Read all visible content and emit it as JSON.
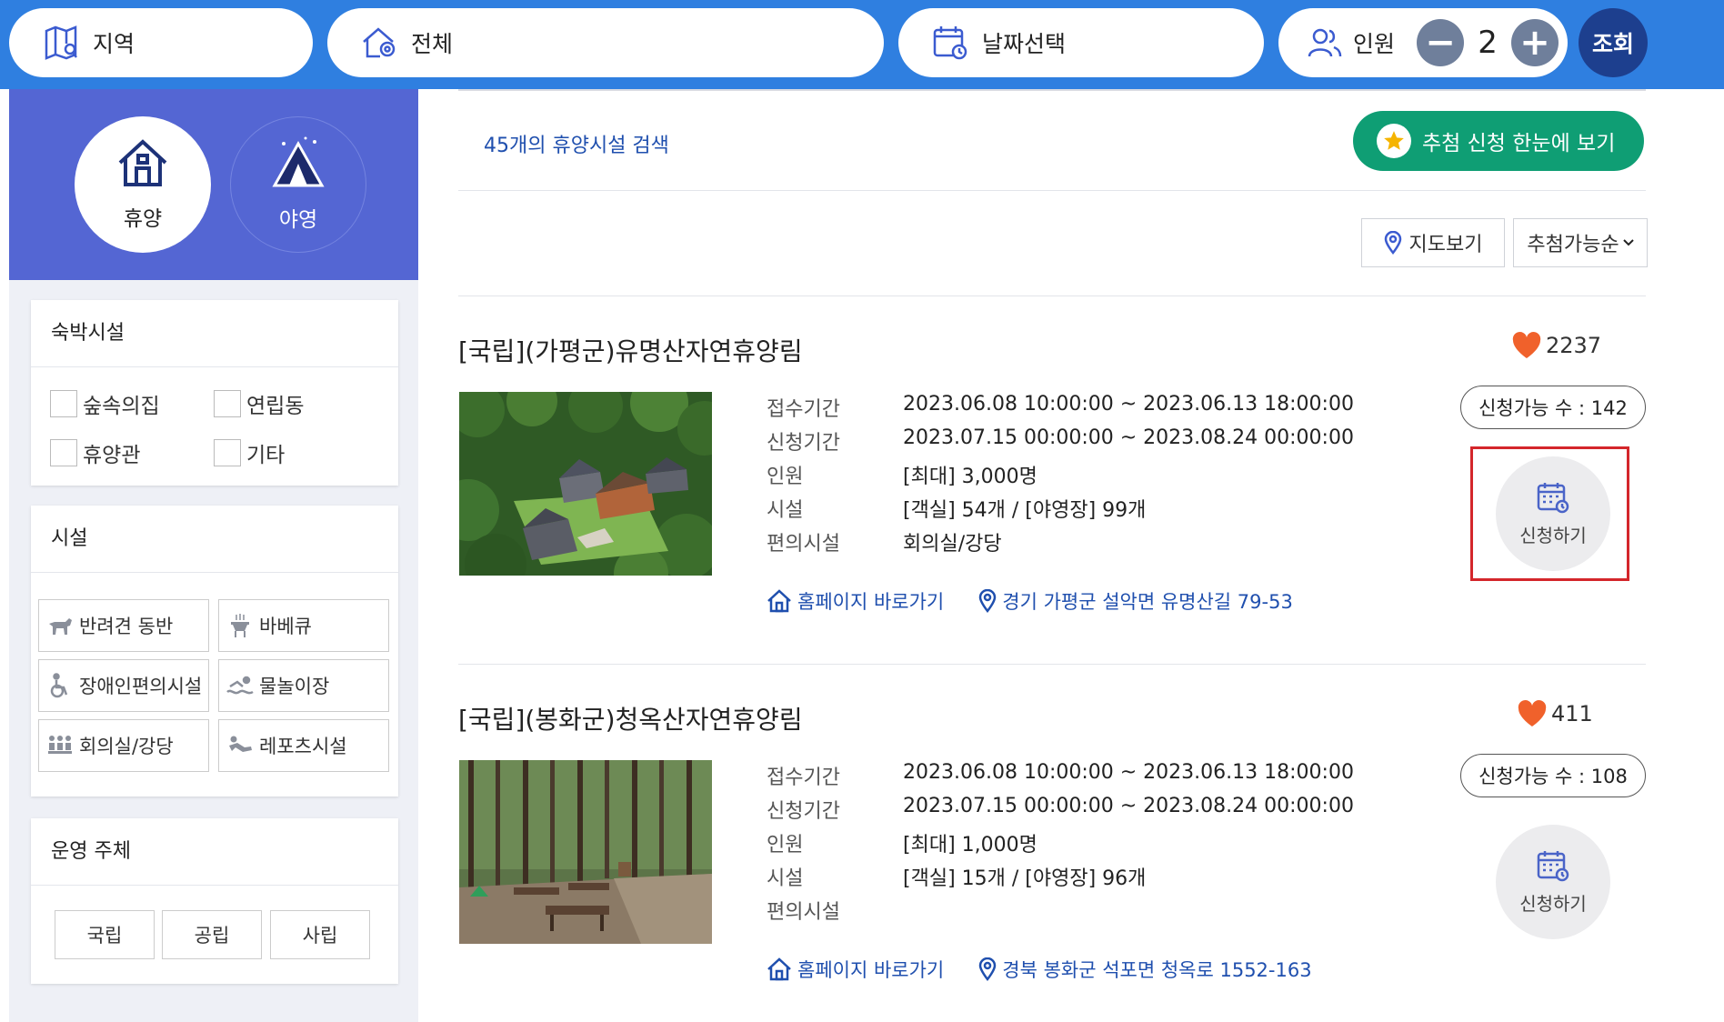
{
  "search_bar": {
    "region_label": "지역",
    "type_label": "전체",
    "date_label": "날짜선택",
    "people_label": "인원",
    "people_count": "2",
    "minus_symbol": "−",
    "plus_symbol": "+",
    "search_button": "조회"
  },
  "category_tabs": [
    {
      "label": "휴양",
      "icon": "house-icon",
      "active": true
    },
    {
      "label": "야영",
      "icon": "tent-icon",
      "active": false
    }
  ],
  "filters": {
    "lodging": {
      "title": "숙박시설",
      "options": [
        "숲속의집",
        "연립동",
        "휴양관",
        "기타"
      ]
    },
    "facility": {
      "title": "시설",
      "options": [
        {
          "label": "반려견 동반",
          "icon": "dog-icon"
        },
        {
          "label": "바베큐",
          "icon": "grill-icon"
        },
        {
          "label": "장애인편의시설",
          "icon": "wheelchair-icon"
        },
        {
          "label": "물놀이장",
          "icon": "swimming-icon"
        },
        {
          "label": "회의실/강당",
          "icon": "meeting-icon"
        },
        {
          "label": "레포츠시설",
          "icon": "leisure-sports-icon"
        }
      ]
    },
    "operator": {
      "title": "운영 주체",
      "options": [
        "국립",
        "공립",
        "사립"
      ]
    }
  },
  "results": {
    "count_text": "45개의 휴양시설 검색",
    "lottery_button": "추첨 신청 한눈에 보기",
    "map_button": "지도보기",
    "sort_selected": "추첨가능순"
  },
  "listings": [
    {
      "title": "[국립](가평군)유명산자연휴양림",
      "likes": "2237",
      "available": "신청가능 수 : 142",
      "apply_label": "신청하기",
      "info": [
        {
          "k": "접수기간",
          "v": "2023.06.08 10:00:00 ~ 2023.06.13 18:00:00"
        },
        {
          "k": "신청기간",
          "v": "2023.07.15 00:00:00 ~ 2023.08.24 00:00:00"
        },
        {
          "k": "인원",
          "v": "[최대] 3,000명"
        },
        {
          "k": "시설",
          "v": "[객실] 54개 / [야영장] 99개"
        },
        {
          "k": "편의시설",
          "v": "회의실/강당"
        }
      ],
      "homepage_link": "홈페이지 바로가기",
      "address": "경기 가평군 설악면 유명산길 79-53"
    },
    {
      "title": "[국립](봉화군)청옥산자연휴양림",
      "likes": "411",
      "available": "신청가능 수 : 108",
      "apply_label": "신청하기",
      "info": [
        {
          "k": "접수기간",
          "v": "2023.06.08 10:00:00 ~ 2023.06.13 18:00:00"
        },
        {
          "k": "신청기간",
          "v": "2023.07.15 00:00:00 ~ 2023.08.24 00:00:00"
        },
        {
          "k": "인원",
          "v": "[최대] 1,000명"
        },
        {
          "k": "시설",
          "v": "[객실] 15개 / [야영장] 96개"
        },
        {
          "k": "편의시설",
          "v": ""
        }
      ],
      "homepage_link": "홈페이지 바로가기",
      "address": "경북 봉화군 석포면 청옥로 1552-163"
    }
  ],
  "colors": {
    "top_bar": "#2f7fe0",
    "sidebar_header": "#5466d3",
    "search_button": "#1d3f8e",
    "lottery_button": "#0f9e74",
    "link": "#1f4fae",
    "heart": "#f0612b",
    "highlight_box": "#d4262b"
  }
}
